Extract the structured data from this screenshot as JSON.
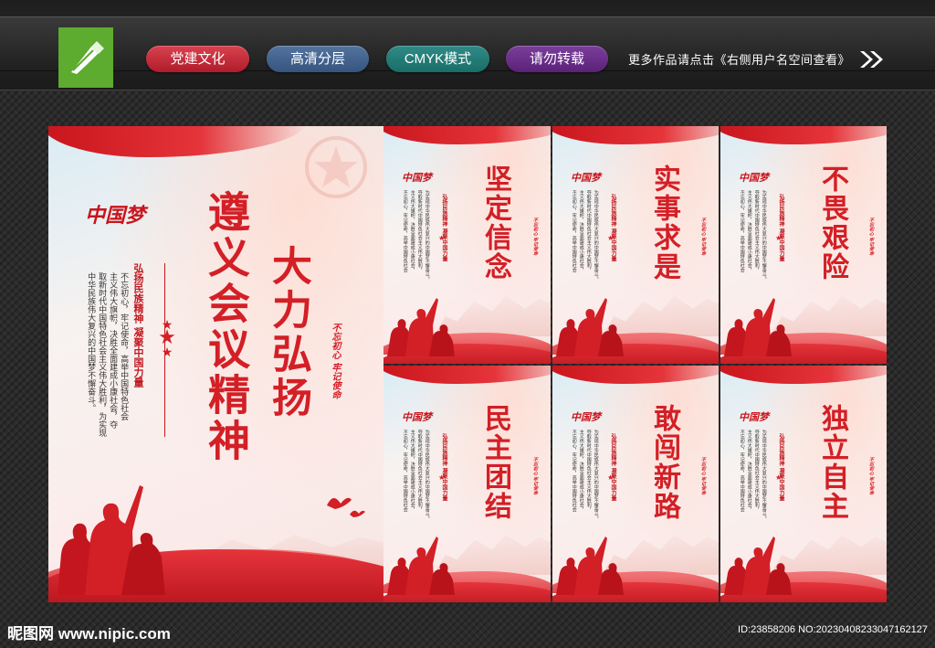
{
  "header": {
    "tags": [
      "党建文化",
      "高清分层",
      "CMYK模式",
      "请勿转载"
    ],
    "notice": "更多作品请点击《右侧用户名空间查看》"
  },
  "main_board": {
    "title_col1": "遵义会议精神",
    "title_col2": "大力弘扬",
    "subtitle": "弘扬民族精神 凝聚中国力量",
    "body": [
      "不忘初心，牢记使命，高举中国特色社会",
      "主义伟大旗帜，决胜全面建成小康社会，夺",
      "取新时代中国特色社会主义伟大胜利，为实现",
      "中华民族伟大复兴的中国梦不懈奋斗。"
    ],
    "seal": "不忘初心 牢记使命",
    "brand": "中国梦"
  },
  "small_boards": [
    {
      "title": "坚定信念"
    },
    {
      "title": "实事求是"
    },
    {
      "title": "不畏艰险"
    },
    {
      "title": "民主团结"
    },
    {
      "title": "敢闯新路"
    },
    {
      "title": "独立自主"
    }
  ],
  "small_common": {
    "subtitle": "弘扬民族精神 凝聚中国力量",
    "seal": "不忘初心 牢记使命",
    "body": [
      "不忘初心，牢记使命，高举中国特色社会",
      "主义伟大旗帜，决胜全面建成小康社会，",
      "夺取新时代中国特色社会主义伟大胜利，",
      "为实现中华民族伟大复兴的中国梦不懈奋斗。"
    ]
  },
  "footer": {
    "site": "昵图网 www.nipic.com",
    "id": "ID:23858206 NO:20230408233047162127"
  }
}
